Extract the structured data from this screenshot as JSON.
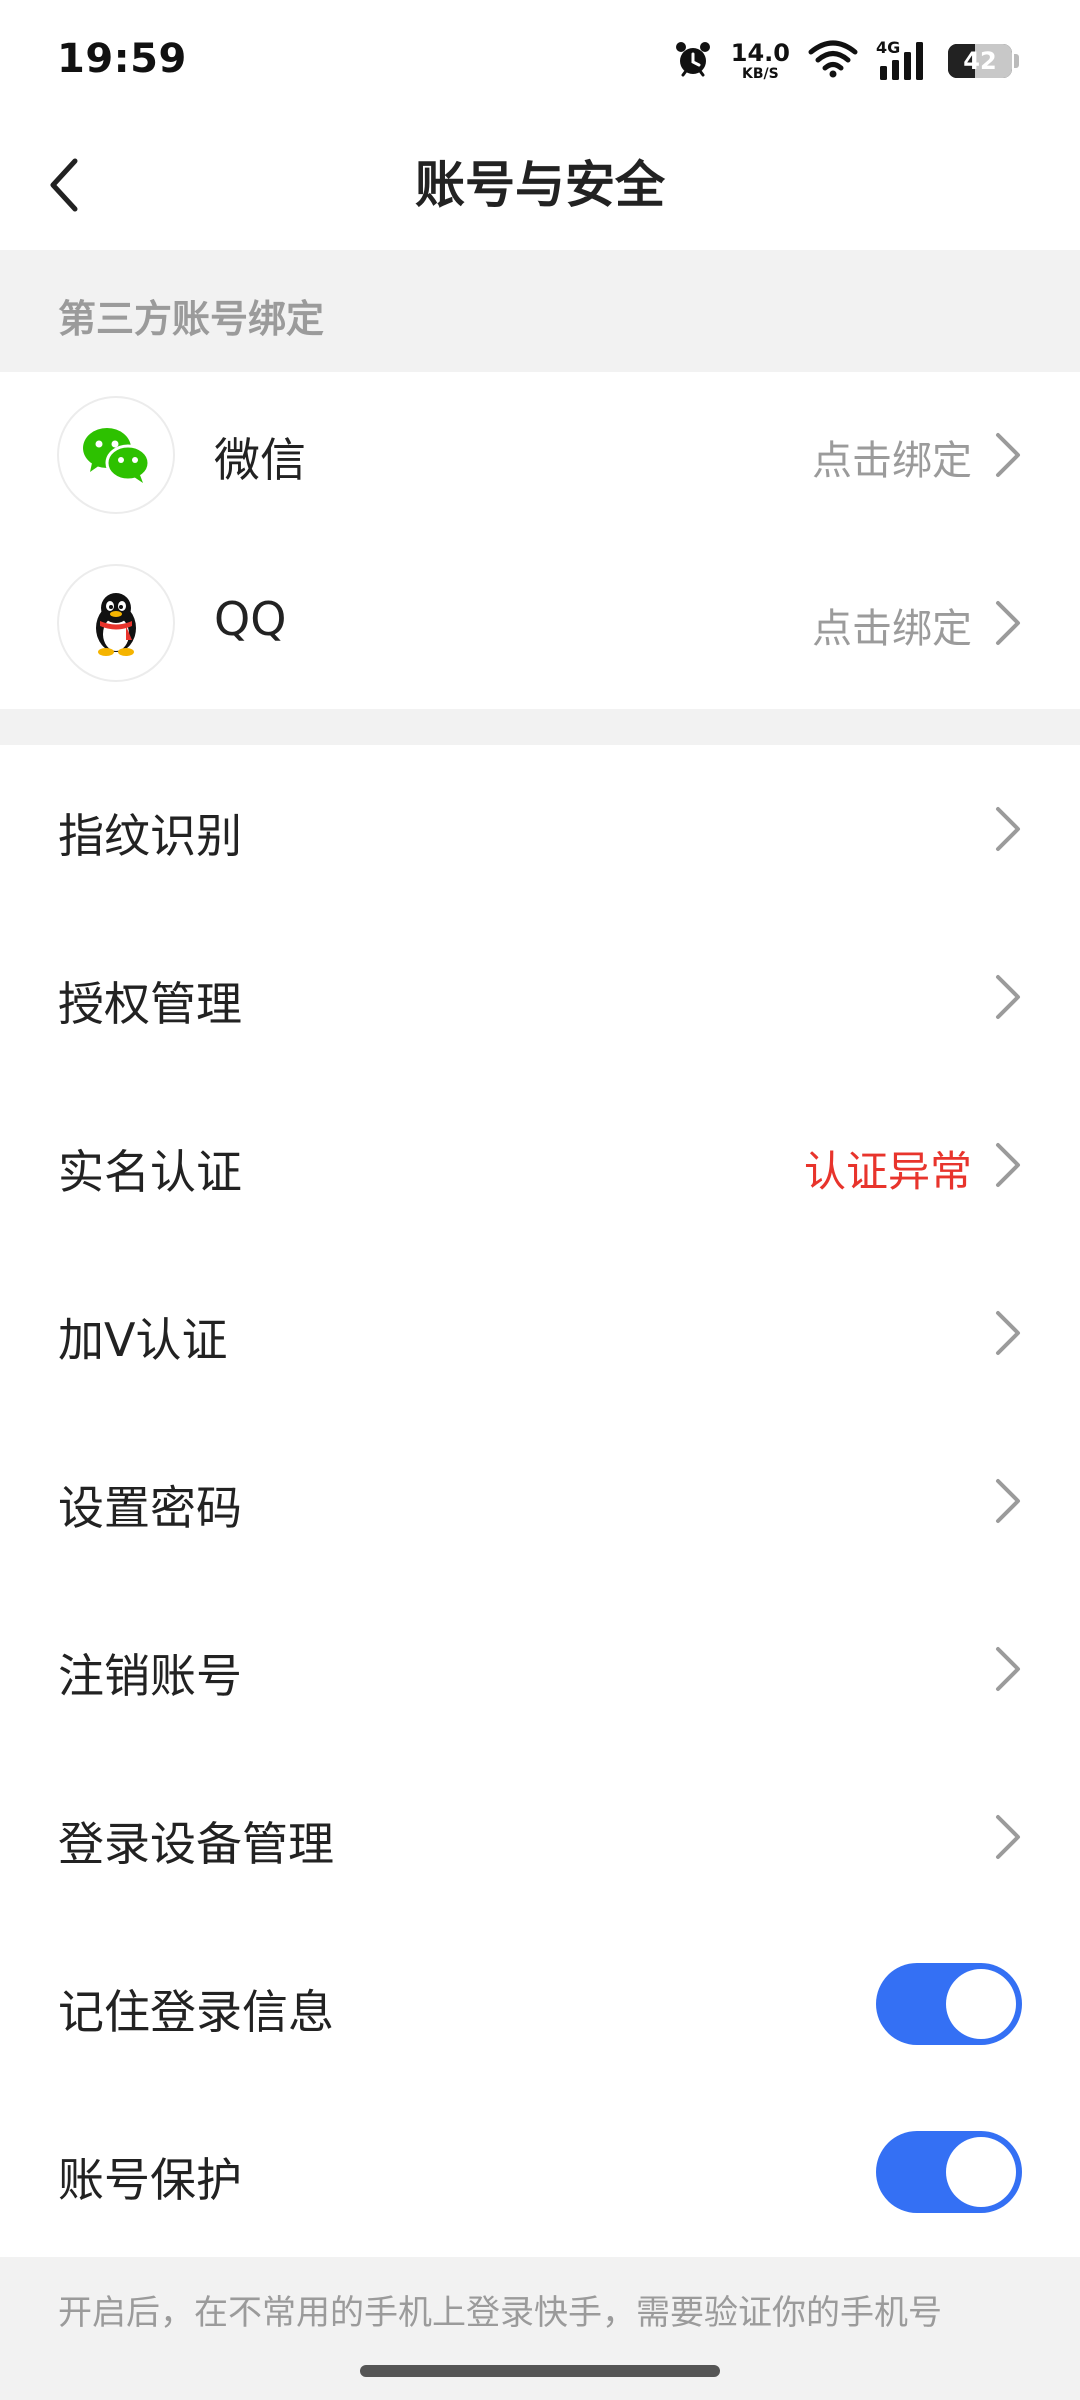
{
  "status_bar": {
    "time": "19:59",
    "net_speed": "14.0",
    "net_unit": "KB/S",
    "network_type": "4G",
    "battery_level": "42",
    "battery_fraction": 0.42,
    "icons": [
      "alarm-icon",
      "wifi-icon",
      "signal-icon",
      "battery-icon"
    ]
  },
  "header": {
    "title": "账号与安全",
    "back_icon": "chevron-left-icon"
  },
  "third_party": {
    "section_title": "第三方账号绑定",
    "items": [
      {
        "label": "微信",
        "action": "点击绑定",
        "icon": "wechat-icon",
        "brand_color": "#2dc100"
      },
      {
        "label": "QQ",
        "action": "点击绑定",
        "icon": "qq-penguin-icon"
      }
    ]
  },
  "menu": {
    "items": [
      {
        "label": "指纹识别"
      },
      {
        "label": "授权管理"
      },
      {
        "label": "实名认证",
        "status": "认证异常",
        "status_color": "#e8342c"
      },
      {
        "label": "加V认证"
      },
      {
        "label": "设置密码"
      },
      {
        "label": "注销账号"
      },
      {
        "label": "登录设备管理"
      }
    ],
    "toggles": [
      {
        "label": "记住登录信息",
        "on": true
      },
      {
        "label": "账号保护",
        "on": true
      }
    ]
  },
  "footer": {
    "note": "开启后，在不常用的手机上登录快手，需要验证你的手机号"
  },
  "colors": {
    "accent": "#3470f4",
    "warning": "#e8342c",
    "section_bg": "#f2f2f2",
    "secondary_text": "#9b9b9b"
  }
}
